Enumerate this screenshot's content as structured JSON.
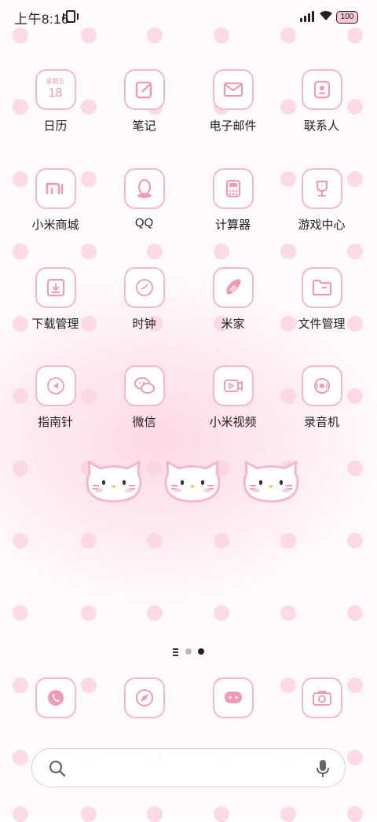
{
  "status_bar": {
    "time": "上午8:16",
    "battery": "100"
  },
  "apps": [
    {
      "label": "日历",
      "icon": "calendar-icon",
      "weekday": "星期五",
      "day": "18"
    },
    {
      "label": "笔记",
      "icon": "notes-icon"
    },
    {
      "label": "电子邮件",
      "icon": "mail-icon"
    },
    {
      "label": "联系人",
      "icon": "contacts-icon"
    },
    {
      "label": "小米商城",
      "icon": "mi-store-icon"
    },
    {
      "label": "QQ",
      "icon": "qq-icon"
    },
    {
      "label": "计算器",
      "icon": "calculator-icon"
    },
    {
      "label": "游戏中心",
      "icon": "trophy-icon"
    },
    {
      "label": "下载管理",
      "icon": "download-icon"
    },
    {
      "label": "时钟",
      "icon": "clock-icon"
    },
    {
      "label": "米家",
      "icon": "mijia-icon"
    },
    {
      "label": "文件管理",
      "icon": "folder-icon"
    },
    {
      "label": "指南针",
      "icon": "compass-icon"
    },
    {
      "label": "微信",
      "icon": "wechat-icon"
    },
    {
      "label": "小米视频",
      "icon": "video-icon"
    },
    {
      "label": "录音机",
      "icon": "recorder-icon"
    }
  ],
  "dock": [
    {
      "icon": "phone-icon"
    },
    {
      "icon": "browser-icon"
    },
    {
      "icon": "messages-icon"
    },
    {
      "icon": "camera-icon"
    }
  ],
  "pager": {
    "total_pages": 2,
    "active_page": 2
  },
  "search": {
    "placeholder": ""
  },
  "colors": {
    "accent": "#f6b7cc",
    "icon": "#f19ab8",
    "dot": "#fbd3e1"
  }
}
